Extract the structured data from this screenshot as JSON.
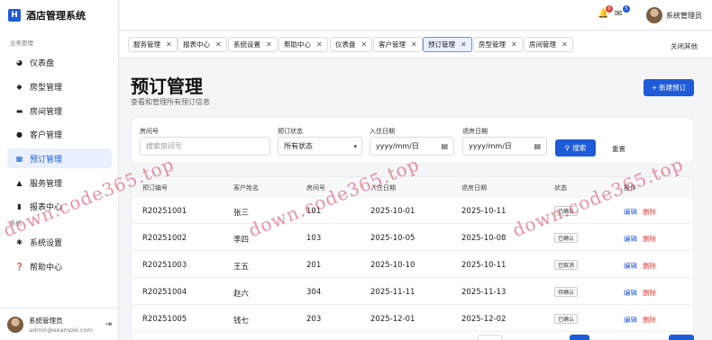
{
  "app": {
    "title": "酒店管理系统",
    "logo_char": "H"
  },
  "sidebar": {
    "section_business": "业务管理",
    "section_system": "系统",
    "items": [
      {
        "label": "仪表盘",
        "icon": "pie-chart-icon"
      },
      {
        "label": "房型管理",
        "icon": "layers-icon"
      },
      {
        "label": "房间管理",
        "icon": "bed-icon"
      },
      {
        "label": "客户管理",
        "icon": "users-icon"
      },
      {
        "label": "预订管理",
        "icon": "calendar-icon",
        "active": true
      },
      {
        "label": "服务管理",
        "icon": "bell-service-icon"
      },
      {
        "label": "报表中心",
        "icon": "file-icon"
      },
      {
        "label": "系统设置",
        "icon": "gear-icon"
      },
      {
        "label": "帮助中心",
        "icon": "help-icon"
      }
    ],
    "user": {
      "name": "系统管理员",
      "email": "admin@example.com"
    }
  },
  "topbar": {
    "notification_count": "0",
    "message_count": "5",
    "user_name": "系统管理员"
  },
  "tabs": {
    "items": [
      "服务管理",
      "报表中心",
      "系统设置",
      "帮助中心",
      "仪表盘",
      "客户管理",
      "预订管理",
      "房型管理",
      "房间管理"
    ],
    "active": "预订管理",
    "close_others": "关闭其他"
  },
  "page": {
    "title": "预订管理",
    "subtitle": "查看和管理所有预订信息",
    "new_button": "新建预订"
  },
  "filter": {
    "room_label": "房间号",
    "room_placeholder": "搜索房间号",
    "status_label": "预订状态",
    "status_value": "所有状态",
    "checkin_label": "入住日期",
    "checkin_placeholder": "yyyy/mm/日",
    "checkout_label": "退房日期",
    "checkout_placeholder": "yyyy/mm/日",
    "search_button": "搜索",
    "reset_button": "重置"
  },
  "table": {
    "headers": [
      "预订编号",
      "客户姓名",
      "房间号",
      "入住日期",
      "退房日期",
      "状态",
      "操作"
    ],
    "edit_label": "编辑",
    "delete_label": "删除",
    "rows": [
      {
        "id": "R20251001",
        "name": "张三",
        "room": "101",
        "checkin": "2025-10-01",
        "checkout": "2025-10-11",
        "status": "已确认"
      },
      {
        "id": "R20251002",
        "name": "李四",
        "room": "103",
        "checkin": "2025-10-05",
        "checkout": "2025-10-08",
        "status": "已确认"
      },
      {
        "id": "R20251003",
        "name": "王五",
        "room": "201",
        "checkin": "2025-10-10",
        "checkout": "2025-10-11",
        "status": "已取消"
      },
      {
        "id": "R20251004",
        "name": "赵六",
        "room": "304",
        "checkin": "2025-11-11",
        "checkout": "2025-11-13",
        "status": "待确认"
      },
      {
        "id": "R20251005",
        "name": "钱七",
        "room": "203",
        "checkin": "2025-12-01",
        "checkout": "2025-12-02",
        "status": "已确认"
      }
    ]
  },
  "watermark": "down.code365.top",
  "colors": {
    "primary": "#1e5bd8",
    "danger": "#e0413c",
    "watermark": "#d63c5a"
  }
}
